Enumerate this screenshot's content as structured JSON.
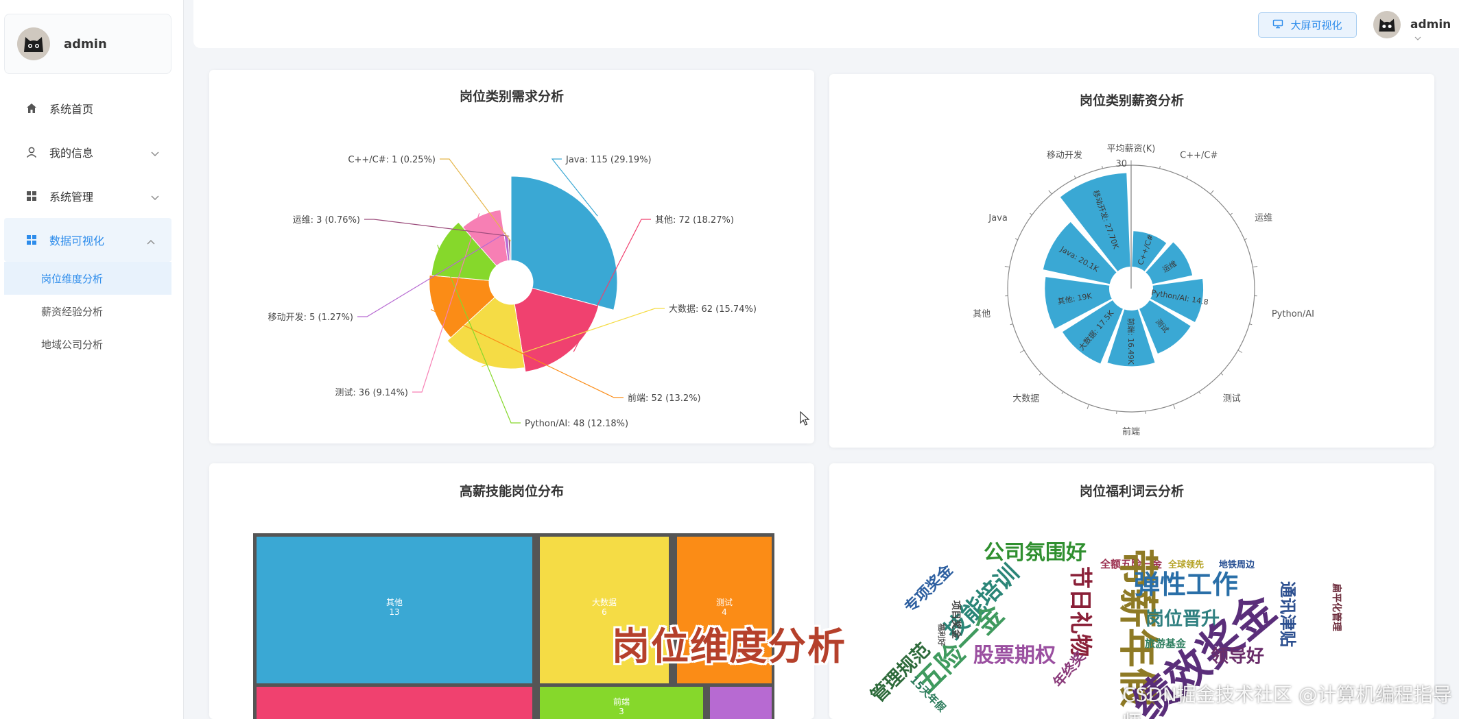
{
  "user": {
    "name": "admin"
  },
  "header": {
    "big_screen_label": "大屏可视化",
    "user_name": "admin"
  },
  "sidebar": {
    "items": [
      {
        "label": "系统首页",
        "icon": "home-icon"
      },
      {
        "label": "我的信息",
        "icon": "user-icon"
      },
      {
        "label": "系统管理",
        "icon": "grid-icon"
      },
      {
        "label": "数据可视化",
        "icon": "grid-icon"
      }
    ],
    "sub_items": [
      {
        "label": "岗位维度分析",
        "active": true
      },
      {
        "label": "薪资经验分析",
        "active": false
      },
      {
        "label": "地域公司分析",
        "active": false
      }
    ]
  },
  "overlay": {
    "caption": "岗位维度分析",
    "watermark": "CSDN掘金技术社区 @计算机编程指导师"
  },
  "cards": {
    "demand": {
      "title": "岗位类别需求分析"
    },
    "salary": {
      "title": "岗位类别薪资分析"
    },
    "treemap": {
      "title": "高薪技能岗位分布"
    },
    "wordcloud": {
      "title": "岗位福利词云分析"
    }
  },
  "colors": {
    "accent": "#2d8ceb",
    "polar_bar": "#3aa8d4"
  },
  "chart_data": [
    {
      "type": "pie",
      "subtype": "rose",
      "title": "岗位类别需求分析",
      "slices": [
        {
          "name": "Java",
          "value": 115,
          "percent": "29.19%",
          "label": "Java: 115 (29.19%)",
          "color": "#3aa8d4"
        },
        {
          "name": "其他",
          "value": 72,
          "percent": "18.27%",
          "label": "其他: 72 (18.27%)",
          "color": "#f0416f"
        },
        {
          "name": "大数据",
          "value": 62,
          "percent": "15.74%",
          "label": "大数据: 62 (15.74%)",
          "color": "#f5dc45"
        },
        {
          "name": "前端",
          "value": 52,
          "percent": "13.2%",
          "label": "前端: 52 (13.2%)",
          "color": "#fb8c16"
        },
        {
          "name": "Python/AI",
          "value": 48,
          "percent": "12.18%",
          "label": "Python/AI: 48 (12.18%)",
          "color": "#86d82b"
        },
        {
          "name": "测试",
          "value": 36,
          "percent": "9.14%",
          "label": "测试: 36 (9.14%)",
          "color": "#f77fb4"
        },
        {
          "name": "移动开发",
          "value": 5,
          "percent": "1.27%",
          "label": "移动开发: 5 (1.27%)",
          "color": "#b76ad2"
        },
        {
          "name": "运维",
          "value": 3,
          "percent": "0.76%",
          "label": "运维: 3 (0.76%)",
          "color": "#9a4a7a"
        },
        {
          "name": "C++/C#",
          "value": 1,
          "percent": "0.25%",
          "label": "C++/C#: 1 (0.25%)",
          "color": "#e5b64a"
        }
      ]
    },
    {
      "type": "bar",
      "subtype": "polar",
      "title": "岗位类别薪资分析",
      "radial_axis_name": "平均薪资(K)",
      "radial_max": 30,
      "radial_tick_label": "30",
      "categories": [
        "C++/C#",
        "运维",
        "Python/AI",
        "测试",
        "前端",
        "大数据",
        "其他",
        "Java",
        "移动开发"
      ],
      "values": [
        10.5,
        12.0,
        14.8,
        14.3,
        16.5,
        17.5,
        19.0,
        20.1,
        27.7
      ],
      "bar_labels": [
        "C++/C#",
        "运维",
        "Python/AI: 14.8",
        "测试",
        "前端: 16.49K",
        "大数据: 17.5K",
        "其他: 19K",
        "Java: 20.1K",
        "移动开发: 27.70K"
      ]
    },
    {
      "type": "heatmap",
      "subtype": "treemap",
      "title": "高薪技能岗位分布",
      "items": [
        {
          "name": "其他",
          "value": 13,
          "color": "#3aa8d4"
        },
        {
          "name": "大数据",
          "value": 6,
          "color": "#f5dc45"
        },
        {
          "name": "测试",
          "value": 4,
          "color": "#fb8c16"
        },
        {
          "name": "前端",
          "value": 3,
          "color": "#86d82b"
        },
        {
          "name": "",
          "value": null,
          "color": "#f0416f"
        },
        {
          "name": "",
          "value": null,
          "color": "#b76ad2"
        }
      ]
    },
    {
      "type": "other",
      "subtype": "wordcloud",
      "title": "岗位福利词云分析",
      "words": [
        {
          "text": "公司氛围好",
          "color": "#2f8f2f"
        },
        {
          "text": "全额五险一金",
          "color": "#9b2f4f"
        },
        {
          "text": "全球领先",
          "color": "#b5a225"
        },
        {
          "text": "地铁周边",
          "color": "#274f93"
        },
        {
          "text": "专项奖金",
          "color": "#2d5fa0"
        },
        {
          "text": "技能培训",
          "color": "#2a8577"
        },
        {
          "text": "节日礼物",
          "color": "#8a2038"
        },
        {
          "text": "带薪年假",
          "color": "#8e7a25"
        },
        {
          "text": "弹性工作",
          "color": "#2a6fa8"
        },
        {
          "text": "通讯津贴",
          "color": "#2c4f8f"
        },
        {
          "text": "五险一金",
          "color": "#3f9a5e"
        },
        {
          "text": "岗位晋升",
          "color": "#2f8080"
        },
        {
          "text": "绩效奖金",
          "color": "#5a2e7a"
        },
        {
          "text": "项目奖金",
          "color": "#444"
        },
        {
          "text": "股票期权",
          "color": "#9a4fa0"
        },
        {
          "text": "旅游基金",
          "color": "#2e7f5f"
        },
        {
          "text": "领导好",
          "color": "#6a2d6a"
        },
        {
          "text": "管理规范",
          "color": "#2d6a3a"
        },
        {
          "text": "年终奖",
          "color": "#8a3a7a"
        },
        {
          "text": "福利好",
          "color": "#555"
        },
        {
          "text": "15天年假",
          "color": "#2a7a5a"
        },
        {
          "text": "扁平化管理",
          "color": "#6a2838"
        }
      ]
    }
  ]
}
